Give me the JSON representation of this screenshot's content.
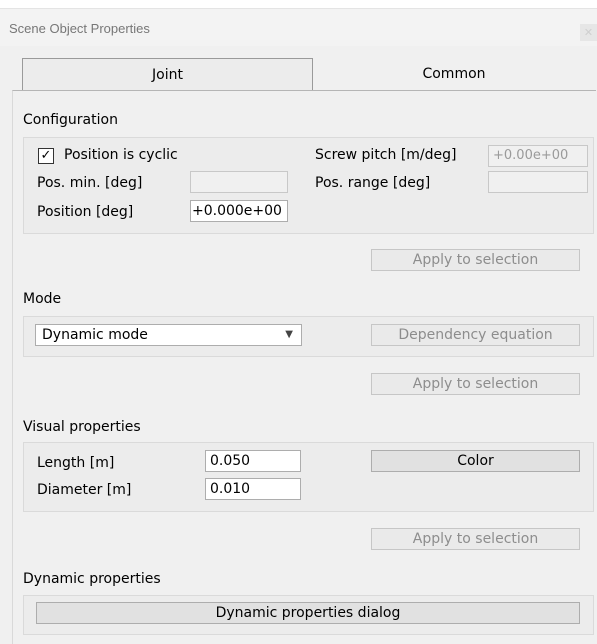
{
  "window": {
    "title": "Scene Object Properties"
  },
  "tabs": [
    {
      "label": "Joint",
      "active": true
    },
    {
      "label": "Common",
      "active": false
    }
  ],
  "configuration": {
    "heading": "Configuration",
    "position_is_cyclic_label": "Position is cyclic",
    "position_is_cyclic_checked": true,
    "checkmark": "✓",
    "screw_pitch_label": "Screw pitch [m/deg]",
    "screw_pitch_value": "+0.00e+00",
    "pos_min_label": "Pos. min. [deg]",
    "pos_min_value": "",
    "pos_range_label": "Pos. range [deg]",
    "pos_range_value": "",
    "position_label": "Position [deg]",
    "position_value": "+0.000e+00",
    "apply_label": "Apply to selection"
  },
  "mode": {
    "heading": "Mode",
    "selected": "Dynamic mode",
    "dependency_label": "Dependency equation",
    "apply_label": "Apply to selection"
  },
  "visual": {
    "heading": "Visual properties",
    "length_label": "Length [m]",
    "length_value": "0.050",
    "diameter_label": "Diameter [m]",
    "diameter_value": "0.010",
    "color_label": "Color",
    "apply_label": "Apply to selection"
  },
  "dynamic": {
    "heading": "Dynamic properties",
    "dialog_label": "Dynamic properties dialog"
  }
}
